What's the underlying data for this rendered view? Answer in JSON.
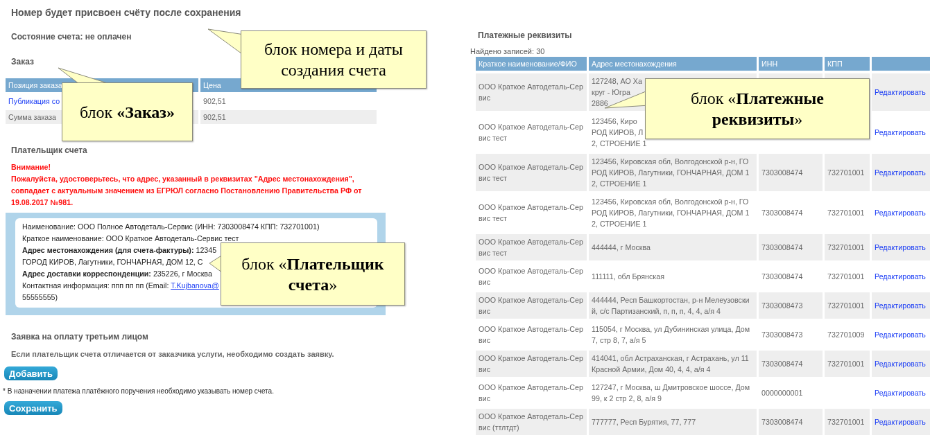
{
  "header": {
    "title": "Номер будет присвоен счёту после сохранения",
    "status": "Состояние счета: не оплачен"
  },
  "order": {
    "heading": "Заказ",
    "columns": [
      "Позиция заказа",
      "Цена"
    ],
    "rows": [
      {
        "kind": "link",
        "item": "Публикация со",
        "price": "902,51"
      },
      {
        "kind": "total",
        "item": "Сумма заказа",
        "price": "902,51"
      }
    ]
  },
  "payer": {
    "heading": "Плательщик счета",
    "warning_title": "Внимание!",
    "warning": "Пожалуйста, удостоверьтесь, что адрес, указанный в реквизитах \"Адрес местонахождения\", совпадает с актуальным значением из ЕГРЮЛ согласно Постановлению Правительства РФ от 19.08.2017 №981.",
    "details": [
      {
        "kind": "text",
        "text": "Наименование: ООО Полное Автодеталь-Сервис (ИНН: 7303008474 КПП: 732701001)"
      },
      {
        "kind": "text",
        "text": "Краткое наименование: ООО Краткое Автодеталь-Сервис тест"
      },
      {
        "kind": "text",
        "text": "**Адрес местонахождения (для счета-фактуры):** 12345"
      },
      {
        "kind": "text",
        "text": "ГОРОД КИРОВ, Лагутники, ГОНЧАРНАЯ, ДОМ 12, С"
      },
      {
        "kind": "text",
        "text": "**Адрес доставки корреспонденции:** 235226, г Москва"
      },
      {
        "kind": "link",
        "text": "Контактная информация: ппп пп пп (Email: ",
        "link": "T.Kujbanova@"
      },
      {
        "kind": "text",
        "text": "55555555)"
      }
    ]
  },
  "third_party": {
    "heading": "Заявка на оплату третьим лицом",
    "note": "Если плательщик счета отличается от заказчика услуги, необходимо создать заявку.",
    "add_button": "Добавить"
  },
  "footnote": "* В назначении платежа платёжного поручения необходимо указывать номер счета.",
  "save_button": "Сохранить",
  "requisites": {
    "heading": "Платежные реквизиты",
    "found": "Найдено записей: 30",
    "columns": [
      "Краткое наименование/ФИО",
      "Адрес местонахождения",
      "ИНН",
      "КПП"
    ],
    "rows": [
      {
        "name": [
          "ООО Краткое Автодеталь-Сер",
          "вис"
        ],
        "address": [
          "127248, АО Ха",
          "круг - Югра",
          "2886"
        ],
        "edit": "Редактировать"
      },
      {
        "name": [
          "ООО Краткое Автодеталь-Сер",
          "вис тест"
        ],
        "address": [
          "123456, Киро",
          "РОД КИРОВ, Л",
          "2, СТРОЕНИЕ 1"
        ],
        "edit": "Редактировать"
      },
      {
        "name": [
          "ООО Краткое Автодеталь-Сер",
          "вис тест"
        ],
        "address": [
          "123456, Кировская обл, Волгодонской р-н, ГО",
          "РОД КИРОВ, Лагутники, ГОНЧАРНАЯ, ДОМ 1",
          "2, СТРОЕНИЕ 1"
        ],
        "inn": "7303008474",
        "kpp": "732701001",
        "edit": "Редактировать"
      },
      {
        "name": [
          "ООО Краткое Автодеталь-Сер",
          "вис тест"
        ],
        "address": [
          "123456, Кировская обл, Волгодонской р-н, ГО",
          "РОД КИРОВ, Лагутники, ГОНЧАРНАЯ, ДОМ 1",
          "2, СТРОЕНИЕ 1"
        ],
        "inn": "7303008474",
        "kpp": "732701001",
        "edit": "Редактировать"
      },
      {
        "name": [
          "ООО Краткое Автодеталь-Сер",
          "вис тест"
        ],
        "address": [
          "444444, г Москва"
        ],
        "inn": "7303008474",
        "kpp": "732701001",
        "edit": "Редактировать"
      },
      {
        "name": [
          "ООО Краткое Автодеталь-Сер",
          "вис"
        ],
        "address": [
          "111111, обл Брянская"
        ],
        "inn": "7303008474",
        "kpp": "732701001",
        "edit": "Редактировать"
      },
      {
        "name": [
          "ООО Краткое Автодеталь-Сер",
          "вис"
        ],
        "address": [
          "444444, Респ Башкортостан, р-н Мелеузовски",
          "й, с/с Партизанский, п, п, п, 4, 4, а/я 4"
        ],
        "inn": "7303008473",
        "kpp": "732701001",
        "edit": "Редактировать"
      },
      {
        "name": [
          "ООО Краткое Автодеталь-Сер",
          "вис"
        ],
        "address": [
          "115054, г Москва, ул Дубининская улица, Дом",
          "7, стр 8, 7, а/я 5"
        ],
        "inn": "7303008473",
        "kpp": "732701009",
        "edit": "Редактировать"
      },
      {
        "name": [
          "ООО Краткое Автодеталь-Сер",
          "вис"
        ],
        "address": [
          "414041, обл Астраханская, г Астрахань, ул 11",
          "Красной Армии, Дом 40, 4, 4, а/я 4"
        ],
        "inn": "7303008474",
        "kpp": "732701001",
        "edit": "Редактировать"
      },
      {
        "name": [
          "ООО Краткое Автодеталь-Сер",
          "вис"
        ],
        "address": [
          "127247, г Москва, ш Дмитровское шоссе, Дом",
          "99, к 2 стр 2, 8, а/я 9"
        ],
        "inn": "0000000001",
        "edit": "Редактировать"
      },
      {
        "name": [
          "ООО Краткое Автодеталь-Сер",
          "вис (ттлтдт)"
        ],
        "address": [
          "777777, Респ Бурятия, 77, 777"
        ],
        "inn": "7303008474",
        "kpp": "732701001",
        "edit": "Редактировать"
      }
    ]
  },
  "callouts": [
    {
      "text": "блок номера и даты создания счета"
    },
    {
      "text": "блок **«Заказ»**"
    },
    {
      "text": "блок «**Платежные реквизиты**»"
    },
    {
      "text": "блок «**Плательщик счета**»"
    }
  ]
}
